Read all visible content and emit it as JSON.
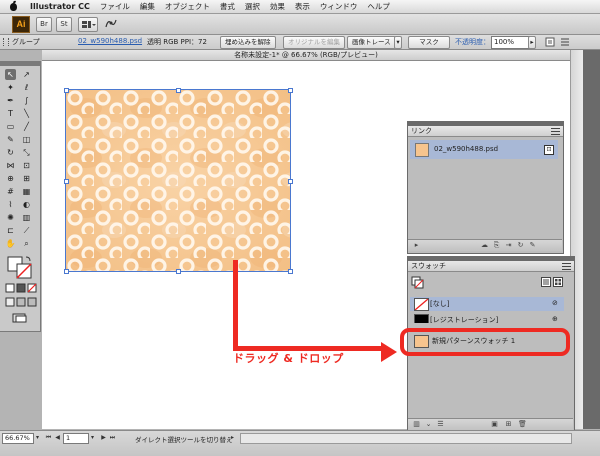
{
  "menubar": {
    "app_name": "Illustrator CC",
    "items": [
      "ファイル",
      "編集",
      "オブジェクト",
      "書式",
      "選択",
      "効果",
      "表示",
      "ウィンドウ",
      "ヘルプ"
    ]
  },
  "appbar": {
    "logo": "Ai",
    "btn1": "Br",
    "btn2": "St"
  },
  "control": {
    "group_label": "グループ",
    "link_name": "02_w590h488.psd",
    "info": "透明 RGB  PPI：72",
    "embed_btn": "埋め込みを解除",
    "original_btn": "オリジナルを編集",
    "trace_btn": "画像トレース",
    "mask_btn": "マスク",
    "opacity_label": "不透明度：",
    "opacity_value": "100%"
  },
  "document": {
    "title": "名称未設定-1* @ 66.67% (RGB/プレビュー)"
  },
  "links_panel": {
    "tab": "リンク",
    "item_name": "02_w590h488.psd"
  },
  "swatches_panel": {
    "tab": "スウォッチ",
    "rows": [
      "[なし]",
      "[レジストレーション]",
      "新規パターンスウォッチ 1"
    ]
  },
  "annotation": {
    "label": "ドラッグ & ドロップ"
  },
  "status": {
    "zoom": "66.67%",
    "page": "1",
    "tool_hint": "ダイレクト選択ツールを切り替え"
  },
  "colors": {
    "accent_red": "#ee2a22",
    "selection_blue": "#4a78d0",
    "pattern_base": "#f6c48e"
  }
}
